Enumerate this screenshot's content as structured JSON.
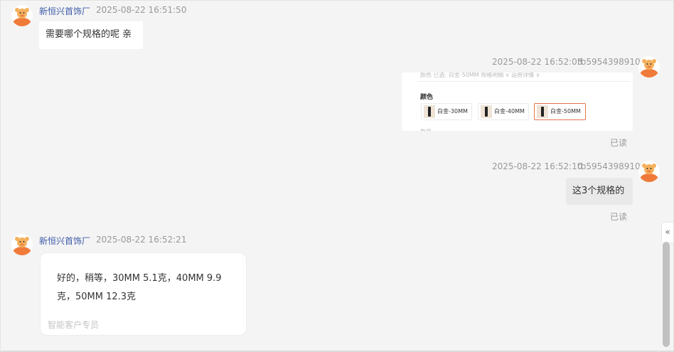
{
  "messages": [
    {
      "sender": "新恒兴首饰厂",
      "time": "2025-08-22 16:51:50",
      "text": "需要哪个规格的呢 亲"
    },
    {
      "sender": "tb5954398910",
      "time": "2025-08-22 16:52:03",
      "status": "已读",
      "image": {
        "header_text": "颜色  已选: 白金-50MM  规格明细 ∨  运费详情 ∨",
        "section_label": "颜色",
        "options": [
          {
            "label": "白金-30MM",
            "selected": false
          },
          {
            "label": "白金-40MM",
            "selected": false
          },
          {
            "label": "白金-50MM",
            "selected": true
          }
        ],
        "footer_text": "数量"
      }
    },
    {
      "sender": "tb5954398910",
      "time": "2025-08-22 16:52:10",
      "status": "已读",
      "text": "这3个规格的"
    },
    {
      "sender": "新恒兴首饰厂",
      "time": "2025-08-22 16:52:21",
      "text_line1": "好的，稍等，30MM 5.1克，40MM 9.9",
      "text_line2": "克，50MM 12.3克",
      "footer": "智能客户专员"
    }
  ],
  "sidebar_toggle": {
    "icon": "double-chevron-left-icon",
    "glyph": "«"
  },
  "colors": {
    "name": "#3b5aa8",
    "selected_border": "#e4754b",
    "avatar": "#f07a3a"
  }
}
